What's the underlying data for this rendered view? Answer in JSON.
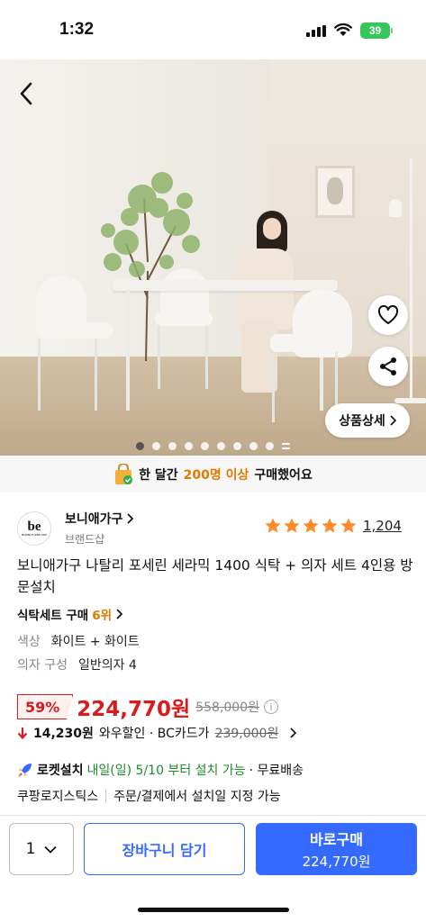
{
  "status_bar": {
    "time": "1:32",
    "battery": "39"
  },
  "hero": {
    "detail_label": "상품상세",
    "dots_total": 10
  },
  "promo": {
    "prefix": "한 달간",
    "highlight": "200명 이상",
    "suffix": "구매했어요"
  },
  "seller": {
    "logo_text": "be",
    "logo_sub": "BONNI FURNITURE",
    "name": "보니애가구",
    "type": "브랜드샵"
  },
  "rating": {
    "stars": 5,
    "count": "1,204"
  },
  "product": {
    "title": "보니애가구 나탈리 포세린 세라믹 1400 식탁 + 의자 세트 4인용 방문설치",
    "rank_label": "식탁세트 구매",
    "rank_value": "6위"
  },
  "options": [
    {
      "key": "색상",
      "value": "화이트 + 화이트"
    },
    {
      "key": "의자 구성",
      "value": "일반의자 4"
    }
  ],
  "price": {
    "discount": "59%",
    "sale": "224,770원",
    "original": "558,000원"
  },
  "card_discount": {
    "amount": "14,230원",
    "label": "와우할인 · BC카드가",
    "card_price": "239,000원"
  },
  "delivery": {
    "rocket_label": "로켓설치",
    "date_text": "내일(일) 5/10 부터 설치 가능",
    "free_shipping": "· 무료배송",
    "logistics": "쿠팡로지스틱스",
    "schedule_note": "주문/결제에서 설치일 지정 가능"
  },
  "bottom_bar": {
    "quantity": "1",
    "cart_label": "장바구니 담기",
    "buy_label": "바로구매",
    "buy_price": "224,770원"
  },
  "colors": {
    "primary": "#346aff",
    "sale_red": "#d81b1b",
    "accent_orange": "#e07a00",
    "rocket_green": "#1f8a2c",
    "battery_green": "#34c759",
    "star_orange": "#ff8c2b"
  }
}
